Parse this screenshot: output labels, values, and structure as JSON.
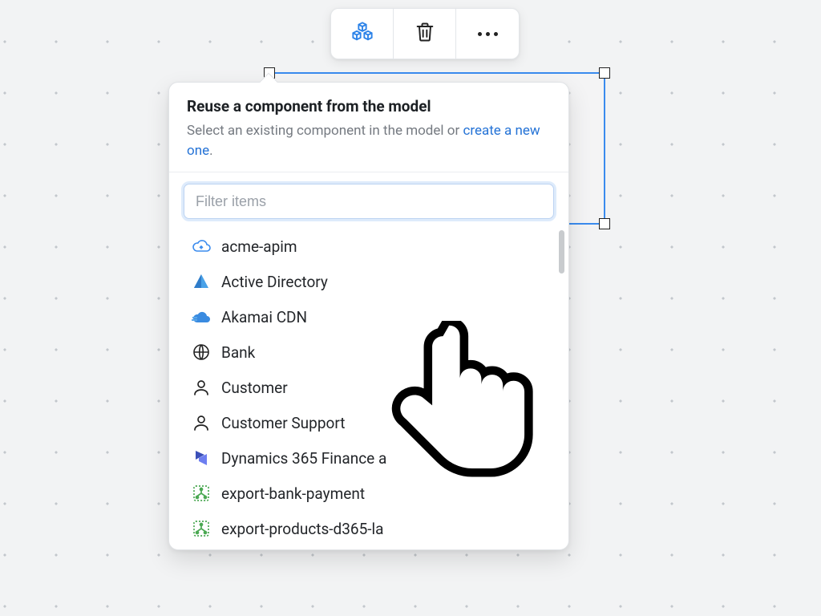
{
  "toolbar": {
    "components_btn": "components",
    "delete_btn": "delete",
    "more_btn": "more"
  },
  "popover": {
    "title": "Reuse a component from the model",
    "subtitle_prefix": "Select an existing component in the model or ",
    "create_link": "create a new one",
    "subtitle_suffix": "."
  },
  "filter": {
    "placeholder": "Filter items",
    "value": ""
  },
  "items": [
    {
      "label": "acme-apim",
      "icon": "cloud-outline-icon"
    },
    {
      "label": "Active Directory",
      "icon": "azure-pyramid-icon"
    },
    {
      "label": "Akamai CDN",
      "icon": "cloud-solid-icon"
    },
    {
      "label": "Bank",
      "icon": "globe-icon"
    },
    {
      "label": "Customer",
      "icon": "person-icon"
    },
    {
      "label": "Customer Support",
      "icon": "person-icon"
    },
    {
      "label": "Dynamics 365 Finance a",
      "icon": "dynamics-icon"
    },
    {
      "label": "export-bank-payment",
      "icon": "logic-app-icon"
    },
    {
      "label": "export-products-d365-la",
      "icon": "logic-app-icon"
    }
  ]
}
